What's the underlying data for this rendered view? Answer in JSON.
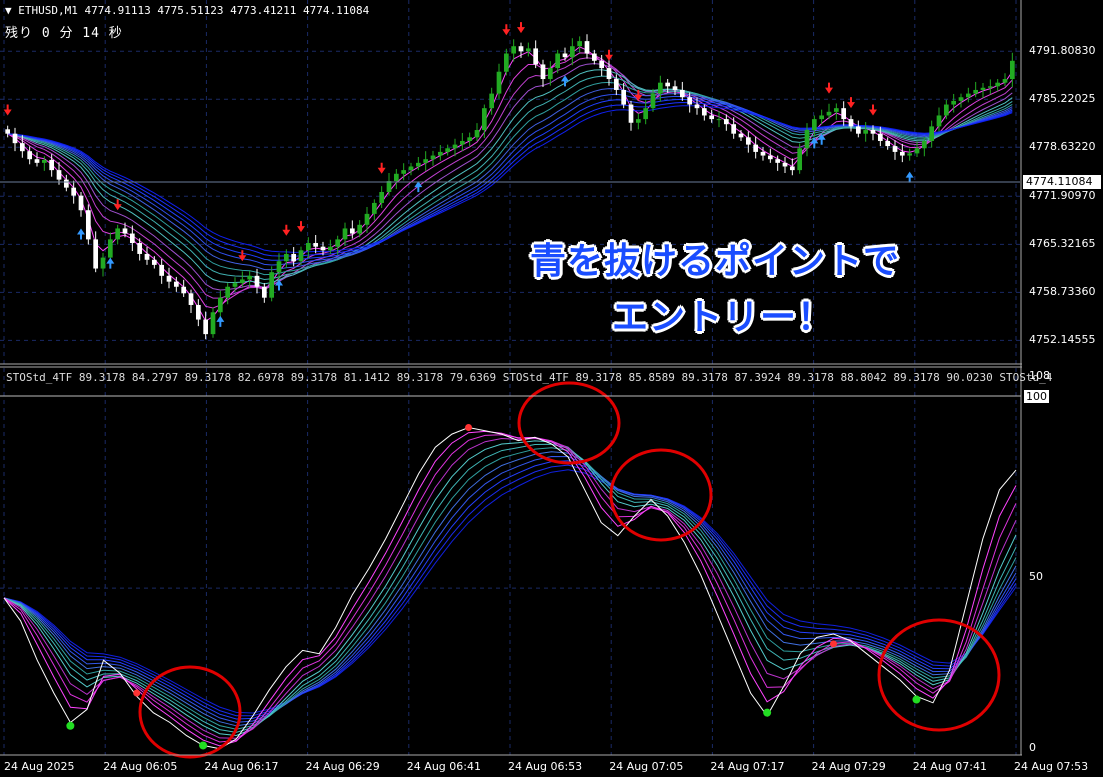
{
  "window": {
    "symbol_header": "ETHUSD,M1  4774.91113 4775.51123 4773.41211 4774.11084",
    "time_remaining": "残り 0 分 14 秒"
  },
  "annotation": {
    "line1": "青を抜けるポイントで",
    "line2": "エントリー！"
  },
  "indicator": {
    "header": "STOStd_4TF 89.3178 84.2797 89.3178 82.6978 89.3178 81.1412 89.3178 79.6369  STOStd_4TF 89.3178 85.8589 89.3178 87.3924 89.3178 88.8042 89.3178 90.0230  STOStd_4",
    "level_max": "108",
    "level_100": "100",
    "level_50": "50",
    "level_0": "0"
  },
  "colors": {
    "bull": "#22aa22",
    "bear": "#ffffff",
    "up_arrow": "#3399ff",
    "down_arrow": "#ff2222",
    "grid": "#1a2a66",
    "circle": "#e00000",
    "main_line": "#ffffff",
    "dot_green": "#22dd22",
    "dot_red": "#ff3333"
  },
  "chart_data": [
    {
      "type": "candlestick",
      "title": "ETHUSD,M1",
      "current_price": "4774.11084",
      "y_tick_labels": [
        "4791.80830",
        "4785.22025",
        "4778.63220",
        "4771.90970",
        "4765.32165",
        "4758.73360",
        "4752.14555"
      ],
      "ylim": [
        4750,
        4795
      ],
      "candles_close": [
        4780.5,
        4779.2,
        4778.1,
        4777.0,
        4776.5,
        4776.9,
        4775.5,
        4774.2,
        4773.1,
        4772.0,
        4770.0,
        4766.0,
        4762.0,
        4763.5,
        4766.0,
        4767.5,
        4766.8,
        4765.5,
        4764.0,
        4763.2,
        4762.5,
        4761.0,
        4760.2,
        4759.5,
        4758.6,
        4757.0,
        4755.0,
        4753.0,
        4756.0,
        4758.0,
        4759.5,
        4760.0,
        4760.5,
        4761.0,
        4759.5,
        4758.0,
        4761.5,
        4763.0,
        4764.0,
        4763.0,
        4764.5,
        4765.5,
        4765.0,
        4764.5,
        4765.0,
        4766.0,
        4767.5,
        4766.8,
        4768.0,
        4769.5,
        4771.0,
        4772.5,
        4774.0,
        4775.0,
        4775.5,
        4776.0,
        4776.5,
        4777.0,
        4777.5,
        4778.0,
        4778.5,
        4779.0,
        4779.5,
        4780.0,
        4781.0,
        4784.0,
        4786.0,
        4789.0,
        4791.5,
        4792.5,
        4791.8,
        4792.2,
        4790.0,
        4788.0,
        4789.5,
        4791.5,
        4791.0,
        4792.5,
        4793.2,
        4791.5,
        4790.5,
        4789.5,
        4788.0,
        4786.5,
        4784.5,
        4782.0,
        4782.5,
        4784.0,
        4786.0,
        4787.5,
        4787.0,
        4786.5,
        4785.5,
        4784.5,
        4784.0,
        4783.0,
        4782.5,
        4782.5,
        4781.8,
        4780.5,
        4780.0,
        4779.0,
        4778.0,
        4777.5,
        4777.0,
        4776.5,
        4776.0,
        4775.5,
        4778.5,
        4781.0,
        4782.5,
        4783.0,
        4783.5,
        4784.0,
        4782.5,
        4781.5,
        4780.5,
        4781.0,
        4780.5,
        4779.5,
        4778.8,
        4778.0,
        4777.5,
        4777.8,
        4778.5,
        4779.5,
        4781.5,
        4783.0,
        4784.5,
        4785.0,
        4785.5,
        4786.0,
        4786.5,
        4786.8,
        4787.0,
        4787.5,
        4788.0,
        4790.5
      ]
    },
    {
      "type": "line",
      "title": "STOStd_4TF",
      "ylim": [
        0,
        108
      ],
      "y_tick_labels": [
        "108",
        "100",
        "50",
        "0"
      ],
      "main_series": [
        47,
        40,
        28,
        18,
        9,
        13,
        28,
        24,
        17,
        12,
        9,
        5,
        2,
        1,
        4,
        11,
        19,
        26,
        31,
        30,
        38,
        48,
        56,
        65,
        75,
        85,
        93,
        97,
        99,
        98,
        97,
        95,
        96,
        94,
        90,
        80,
        70,
        66,
        72,
        77,
        72,
        64,
        54,
        42,
        30,
        18,
        11,
        20,
        30,
        35,
        36,
        34,
        30,
        26,
        22,
        17,
        15,
        25,
        45,
        65,
        80,
        86
      ],
      "green_dot_values": [
        8,
        2,
        12,
        16
      ],
      "red_dot_values": [
        18,
        33,
        99
      ]
    }
  ],
  "x_tick_labels": [
    "24 Aug 2025",
    "24 Aug 06:05",
    "24 Aug 06:17",
    "24 Aug 06:29",
    "24 Aug 06:41",
    "24 Aug 06:53",
    "24 Aug 07:05",
    "24 Aug 07:17",
    "24 Aug 07:29",
    "24 Aug 07:41",
    "24 Aug 07:53"
  ]
}
